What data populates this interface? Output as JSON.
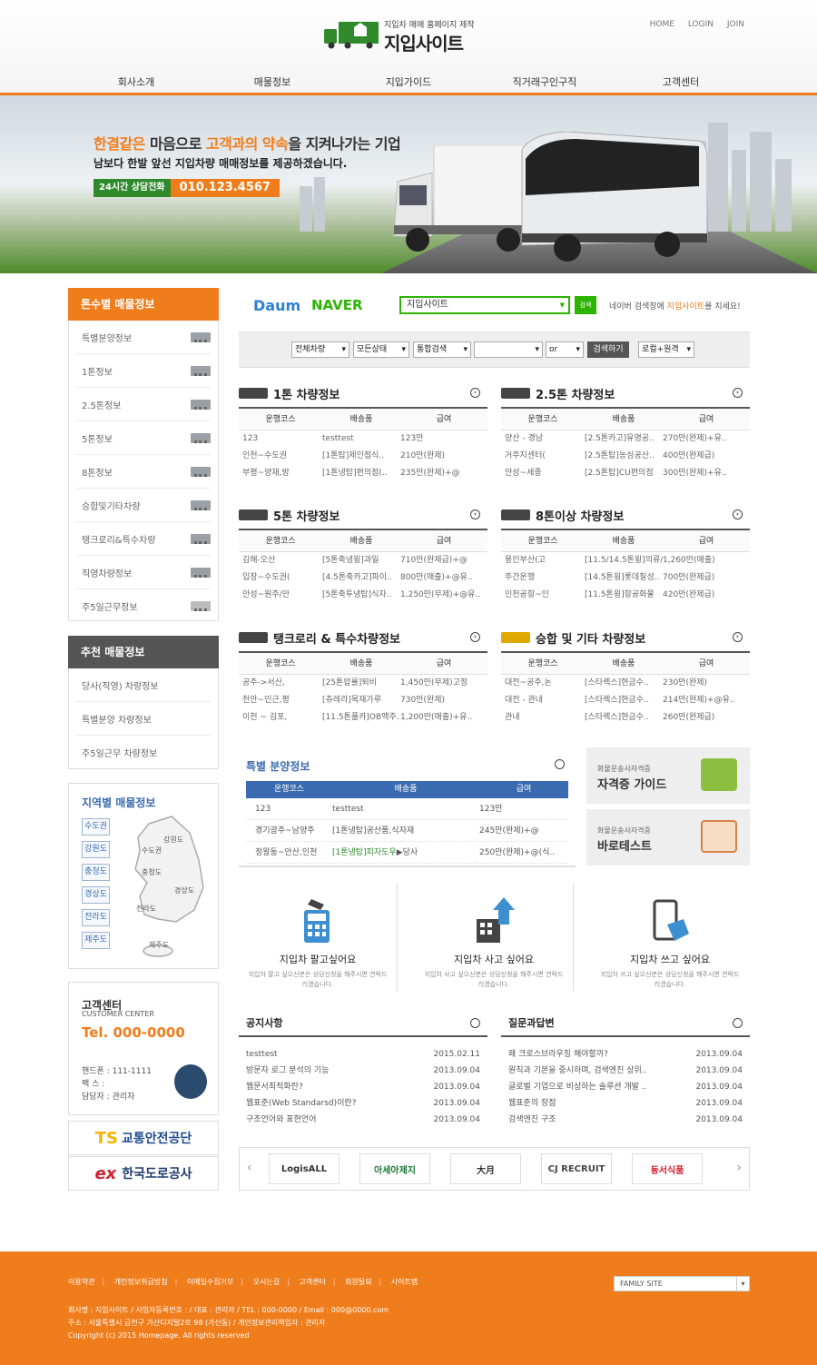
{
  "header": {
    "tagline": "지입차 매매 홈페이지 제작",
    "site_name": "지입사이트",
    "top_links": [
      "HOME",
      "LOGIN",
      "JOIN"
    ],
    "nav": [
      "회사소개",
      "매물정보",
      "지입가이드",
      "직거래구인구직",
      "고객센터"
    ]
  },
  "banner": {
    "headline_1": "한결같은",
    "headline_2": " 마음으로 ",
    "headline_3": "고객과의 약속",
    "headline_4": "을 지켜나가는 기업",
    "sub": "남보다 한발 앞선 지입차량 매매정보를 제공하겠습니다.",
    "consult_label": "24시간 상담전화",
    "consult_phone": "010.123.4567"
  },
  "left": {
    "ton_title": "톤수별 매물정보",
    "ton_items": [
      "특별분양정보",
      "1톤정보",
      "2.5톤정보",
      "5톤정보",
      "8톤정보",
      "승합및기타차량",
      "탱크로리&특수차량",
      "직영차량정보",
      "주5일근무정보"
    ],
    "rec_title": "추천 매물정보",
    "rec_items": [
      "당사(직영) 차량정보",
      "특별분양 차량정보",
      "주5일근무 차량정보"
    ],
    "region_title": "지역별 매물정보",
    "region_buttons": [
      "수도권",
      "강원도",
      "충청도",
      "경상도",
      "전라도",
      "제주도"
    ],
    "map_labels": [
      "강원도",
      "수도권",
      "충청도",
      "경상도",
      "전라도",
      "제주도"
    ],
    "cs_title": "고객센터",
    "cs_sub": "CUSTOMER CENTER",
    "cs_tel": "Tel. 000-0000",
    "cs_mobile": "핸드폰 : 111-1111",
    "cs_fax": "팩 스 :",
    "cs_manager": "담당자 : 관리자",
    "banner_ts": "교통안전공단",
    "banner_ts_logo": "TS",
    "banner_ex": "한국도로공사",
    "banner_ex_logo": "ex"
  },
  "search": {
    "daum": "Daum",
    "naver": "NAVER",
    "keyword": "지입사이트",
    "btn": "검색",
    "note_a": "네이버 검색창에 ",
    "note_b": "지입사이트",
    "note_c": "를 치세요!"
  },
  "filter": {
    "sel1": "전체차량",
    "sel2": "모든상태",
    "sel3": "통합검색",
    "sel4": "or",
    "btn": "검색하기",
    "sel5": "로컬+원격"
  },
  "table_head": [
    "운행코스",
    "배송품",
    "급여"
  ],
  "boards": [
    {
      "title": "1톤 차량정보",
      "rows": [
        [
          "123",
          "testtest",
          "123만"
        ],
        [
          "인천~수도권",
          "[1톤탑]제인점식..",
          "210만(완제)"
        ],
        [
          "부평~양재,방",
          "[1톤냉탑]편의점(..",
          "235만(완제)+@"
        ]
      ]
    },
    {
      "title": "2.5톤 차량정보",
      "rows": [
        [
          "양산 - 경남",
          "[2.5톤카고]유명공..",
          "270만(완제)+유.."
        ],
        [
          "거주지센터(",
          "[2.5톤탑]농심공산..",
          "400만(완제급)"
        ],
        [
          "안성~세종",
          "[2.5톤탑]CU편의점",
          "300만(완제)+유.."
        ]
      ]
    },
    {
      "title": "5톤 차량정보",
      "rows": [
        [
          "김해-오산",
          "[5톤축냉윙]과일",
          "710만(완제급)+@"
        ],
        [
          "입장~수도권(",
          "[4.5톤축카고]파이..",
          "800만(매출)+@유.."
        ],
        [
          "안성~원주/안",
          "[5톤축투냉탑]식자..",
          "1,250만(무제)+@유.."
        ]
      ]
    },
    {
      "title": "8톤이상 차량정보",
      "rows": [
        [
          "용인부산(고",
          "[11.5/14.5톤윙]의류/..",
          "1,260만(매출)"
        ],
        [
          "주간운행",
          "[14.5톤윙]롯데칠성..",
          "700만(완제급)"
        ],
        [
          "인천공항~인",
          "[11.5톤윙]항공화물",
          "420만(완제급)"
        ]
      ]
    },
    {
      "title": "탱크로리 & 특수차량정보",
      "rows": [
        [
          "공주->서산,",
          "[25톤압률]퇴비",
          "1,450만(무제)고정"
        ],
        [
          "천안~인근,평",
          "[츄레라]목재가루",
          "730만(완제)"
        ],
        [
          "이천 ~ 김포,",
          "[11.5톤풀카]OB맥주..",
          "1,200만(매출)+유.."
        ]
      ]
    },
    {
      "title": "승합 및 기타 차량정보",
      "rows": [
        [
          "대전~공주,논",
          "[스타렉스]현금수..",
          "230만(완제)"
        ],
        [
          "대전 - 관내",
          "[스타렉스]현금수..",
          "214만(완제)+@유.."
        ],
        [
          "관내",
          "[스타렉스]현금수..",
          "260만(완제급)"
        ]
      ]
    }
  ],
  "special": {
    "title": "특별 분양정보",
    "rows": [
      [
        "123",
        "testtest",
        "123만"
      ],
      [
        "경기광주~남양주",
        "[1톤냉탑]공산품,식자재",
        "245만(완제)+@"
      ],
      [
        "정왕동~안산,인천",
        "[1톤냉탑]피자도우",
        "▶당사",
        "250만(완제)+@(식.."
      ]
    ]
  },
  "guides": [
    {
      "small": "화물운송사자격증",
      "big": "자격증 가이드"
    },
    {
      "small": "화물운송사자격증",
      "big": "바로테스트"
    }
  ],
  "services": [
    {
      "title": "지입차 팔고싶어요",
      "desc": "지입차 팔고 싶으신분은 상담신청을 해주시면 연락드리겠습니다."
    },
    {
      "title": "지입차 사고 싶어요",
      "desc": "지입차 사고 싶으신분은 상담신청을 해주시면 연락드리겠습니다."
    },
    {
      "title": "지입차 쓰고 싶어요",
      "desc": "지입차 쓰고 싶으신분은 상담신청을 해주시면 연락드리겠습니다."
    }
  ],
  "notice": {
    "title": "공지사항",
    "rows": [
      [
        "testtest",
        "2015.02.11"
      ],
      [
        "방문자 로그 분석의 기능",
        "2013.09.04"
      ],
      [
        "웹문서최적화란?",
        "2013.09.04"
      ],
      [
        "웹표준(Web Standarsd)이란?",
        "2013.09.04"
      ],
      [
        "구조언어와 표현언어",
        "2013.09.04"
      ]
    ]
  },
  "qna": {
    "title": "질문과답변",
    "rows": [
      [
        "왜 크로스브라우징 해야할까?",
        "2013.09.04"
      ],
      [
        "원칙과 기본을 중시하며, 검색엔진 상위..",
        "2013.09.04"
      ],
      [
        "글로벌 기업으로 비상하는 솔루션 개발 ..",
        "2013.09.04"
      ],
      [
        "웹표준의 장점",
        "2013.09.04"
      ],
      [
        "검색엔진 구조",
        "2013.09.04"
      ]
    ]
  },
  "partners": [
    "LogisALL",
    "아세아제지",
    "大月",
    "CJ RECRUIT",
    "동서식품"
  ],
  "footer": {
    "links": [
      "이용약관",
      "개인정보취급방침",
      "이메일수집거부",
      "오시는길",
      "고객센터",
      "회원탈퇴",
      "사이트맵"
    ],
    "family": "FAMILY SITE",
    "info1": "회사명 : 지입사이트 / 사업자등록번호 : / 대표 : 관리자 / TEL : 000-0000 / Email : 000@0000.com",
    "info2": "주소 : 서울특별시 금천구 가산디지털2로 98 (가산동) / 개인정보관리책임자 : 관리자",
    "copy": "Copyright (c) 2015 Homepage. All rights reserved"
  },
  "colors": {
    "accent": "#f07d1c",
    "blue": "#3a6bb0",
    "naver_green": "#2db400",
    "dark_header": "#555555"
  }
}
